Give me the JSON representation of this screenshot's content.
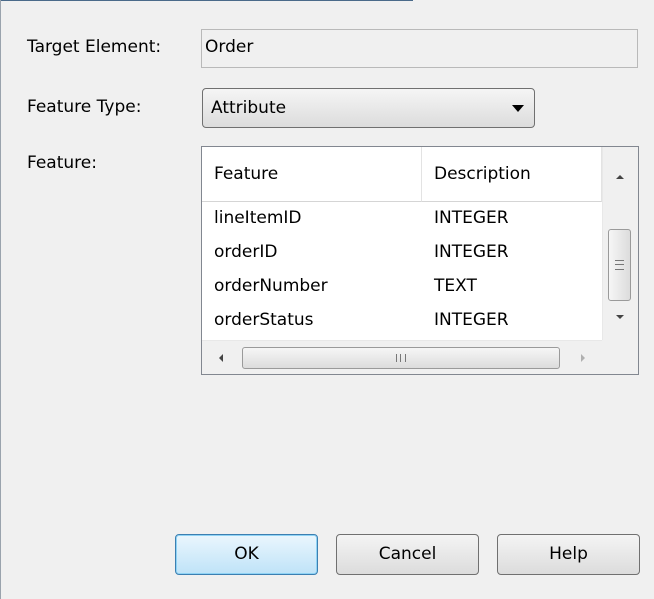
{
  "form": {
    "target_element_label": "Target Element:",
    "target_element_value": "Order",
    "feature_type_label": "Feature Type:",
    "feature_type_value": "Attribute",
    "feature_label": "Feature:"
  },
  "feature_list": {
    "columns": [
      "Feature",
      "Description"
    ],
    "rows": [
      {
        "feature": "lineItemID",
        "description": "INTEGER"
      },
      {
        "feature": "orderID",
        "description": "INTEGER"
      },
      {
        "feature": "orderNumber",
        "description": "TEXT"
      },
      {
        "feature": "orderStatus",
        "description": "INTEGER"
      }
    ]
  },
  "buttons": {
    "ok": "OK",
    "cancel": "Cancel",
    "help": "Help"
  },
  "icons": {
    "dropdown": "chevron-down-icon",
    "scroll_up": "arrow-up-icon",
    "scroll_down": "arrow-down-icon",
    "scroll_left": "arrow-left-icon",
    "scroll_right": "arrow-right-icon"
  },
  "colors": {
    "dialog_background": "#f0f0f0",
    "default_button_border": "#3c7fb1"
  }
}
